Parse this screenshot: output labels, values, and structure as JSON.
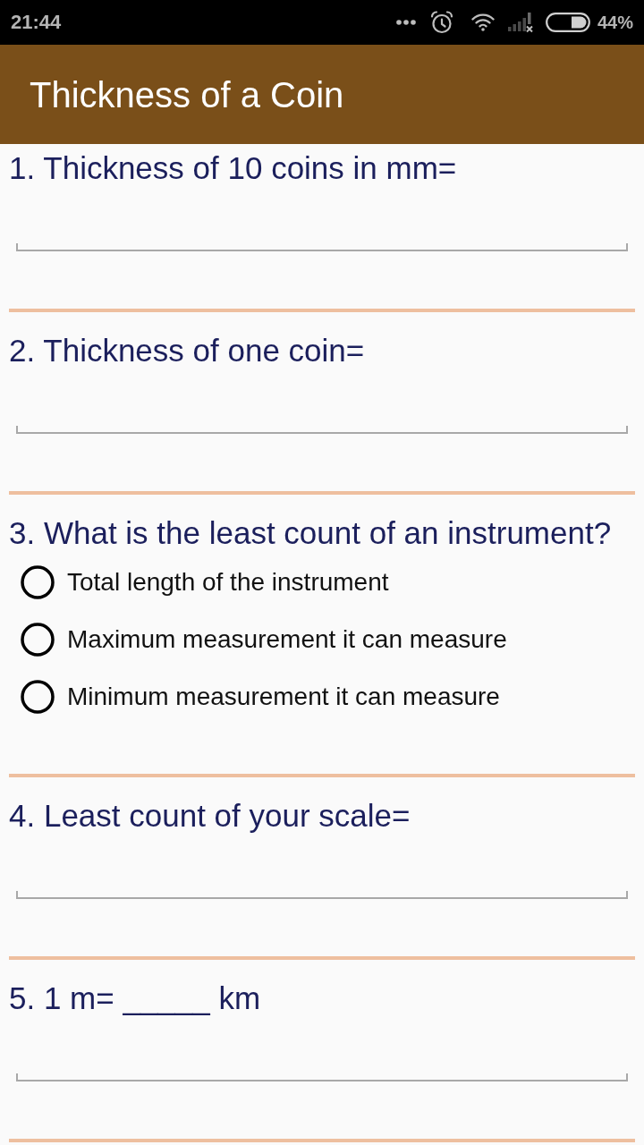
{
  "status_bar": {
    "time": "21:44",
    "battery": "44%"
  },
  "app_bar": {
    "title": "Thickness of a Coin"
  },
  "questions": [
    {
      "kind": "text",
      "prompt": "1. Thickness of 10 coins in mm="
    },
    {
      "kind": "text",
      "prompt": "2. Thickness of one coin="
    },
    {
      "kind": "choice",
      "prompt": "3. What is the least count of an instrument?",
      "options": [
        {
          "label": "Total length of the instrument",
          "selected": false
        },
        {
          "label": "Maximum measurement it can measure",
          "selected": false
        },
        {
          "label": "Minimum measurement it can measure",
          "selected": false
        }
      ]
    },
    {
      "kind": "text",
      "prompt": "4. Least count of your scale="
    },
    {
      "kind": "text",
      "prompt": "5. 1 m= _____ km"
    }
  ]
}
